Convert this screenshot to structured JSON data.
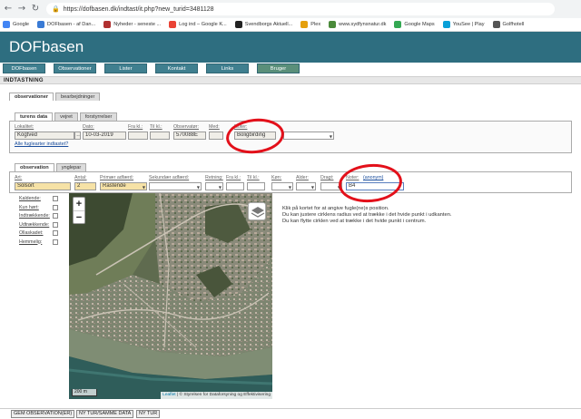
{
  "browser": {
    "url": "https://dofbasen.dk/indtast/it.php?new_turid=3481128",
    "bookmarks": [
      {
        "label": "Google",
        "color": "#4285f4"
      },
      {
        "label": "DOFbasen - af Dan...",
        "color": "#3a7bd5"
      },
      {
        "label": "Nyheder - seneste ...",
        "color": "#b03030"
      },
      {
        "label": "Log ind – Google K...",
        "color": "#ea4335"
      },
      {
        "label": "Svendborgs Aktuell...",
        "color": "#222222"
      },
      {
        "label": "Plex",
        "color": "#e5a00d"
      },
      {
        "label": "www.sydfynsnatur.dk",
        "color": "#4a8a3a"
      },
      {
        "label": "Google Maps",
        "color": "#34a853"
      },
      {
        "label": "YouSee | Play",
        "color": "#0aa0d8"
      },
      {
        "label": "Golfhotell",
        "color": "#555555"
      }
    ]
  },
  "site": {
    "title": "DOFbasen",
    "menu": [
      "DOFbasen",
      "Observationer",
      "Lister",
      "Kontakt",
      "Links",
      "Bruger"
    ]
  },
  "section_title": "INDTASTNING",
  "outer_tabs": [
    "observationer",
    "bearbejdninger"
  ],
  "trip_tabs": [
    "turens data",
    "vejret",
    "forstyrrelser"
  ],
  "trip": {
    "lokalitet_label": "Lokalitet:",
    "lokalitet_value": "Kogtved",
    "dato_label": "Dato:",
    "dato_value": "10-03-2019",
    "fra_label": "Fra kl.:",
    "til_label": "Til kl.:",
    "observator_label": "Observatør:",
    "observator_value": "570088E",
    "med_label": "Med:",
    "noter_label": "Noter:",
    "noter_value": "Boligbirding",
    "link": "Alle fuglearter indtastet?"
  },
  "obs_tabs": [
    "observation",
    "ynglepar"
  ],
  "observation": {
    "art_label": "Art:",
    "art_value": "Solsort",
    "antal_label": "Antal:",
    "antal_value": "2",
    "adfaerd_label": "Primær adfærd:",
    "adfaerd_value": "Rastende",
    "sek_label": "Sekundær adfærd:",
    "retning_label": "Retning:",
    "fra_label": "Fra kl.:",
    "til_label": "Til kl.:",
    "koen_label": "Køn:",
    "alder_label": "Alder:",
    "dragt_label": "Dragt:",
    "noter_label": "Noter:",
    "noter_anon": "(anonym)",
    "noter_value": "B4"
  },
  "checkboxes": [
    "Kaldende:",
    "Kun hørt:",
    "Indtrækkende:",
    "Udtrækkende:",
    "Ollaskadet:",
    "Hemmelig:"
  ],
  "map": {
    "zoom_in": "+",
    "zoom_out": "−",
    "scale": "200 m",
    "attribution_leaflet": "Leaflet",
    "attribution_text": " | © Styrelsen for Dataforsyning og Effektivisering"
  },
  "instructions": [
    "Klik på kortet for at angive fugle(ne)s position.",
    "Du kan justere cirklens radius ved at trække i det hvide punkt i udkanten.",
    "Du kan flytte cirklen ved at trække i det hvide punkt i centrum."
  ],
  "buttons": [
    "GEM OBSERVATION(ER)",
    "NY TUR/SAMME DATA",
    "NY TUR"
  ]
}
